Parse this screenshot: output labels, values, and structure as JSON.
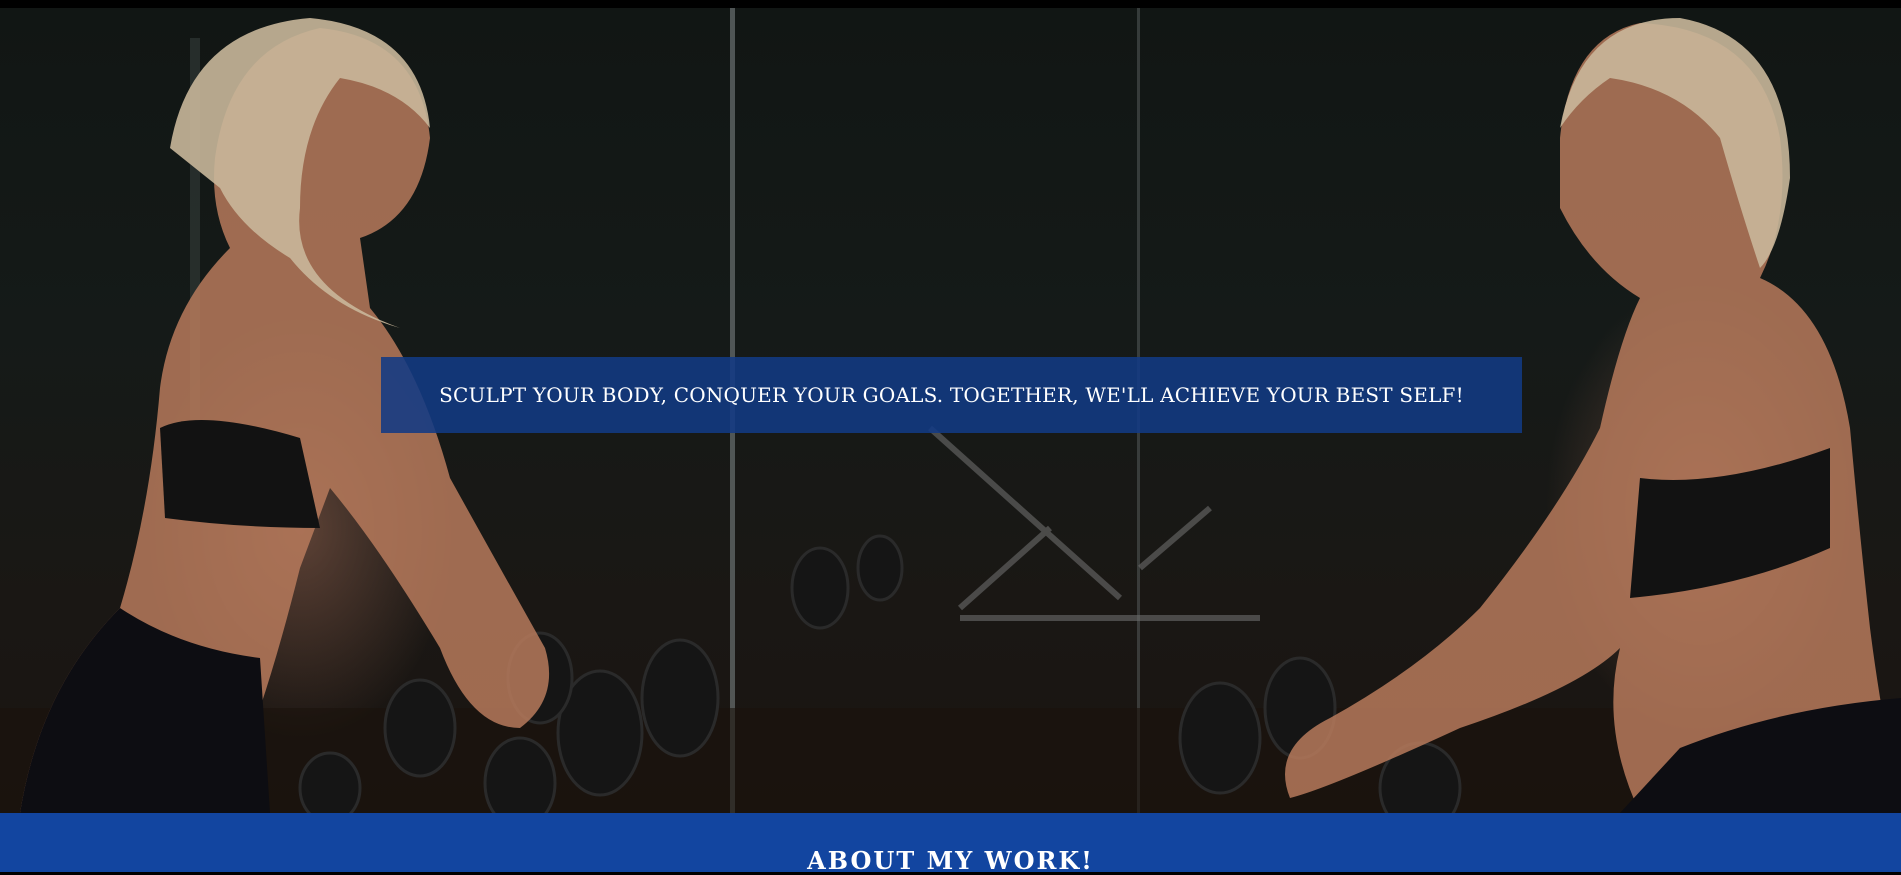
{
  "hero": {
    "image_description_icon": "gym-mirror-photo",
    "banner_text": "SCULPT YOUR BODY, CONQUER YOUR GOALS. TOGETHER, WE'LL ACHIEVE YOUR BEST SELF!"
  },
  "about": {
    "title": "ABOUT MY WORK!"
  },
  "colors": {
    "banner_bg": "#123a84",
    "section_bg": "#1245a0",
    "text": "#ffffff"
  }
}
